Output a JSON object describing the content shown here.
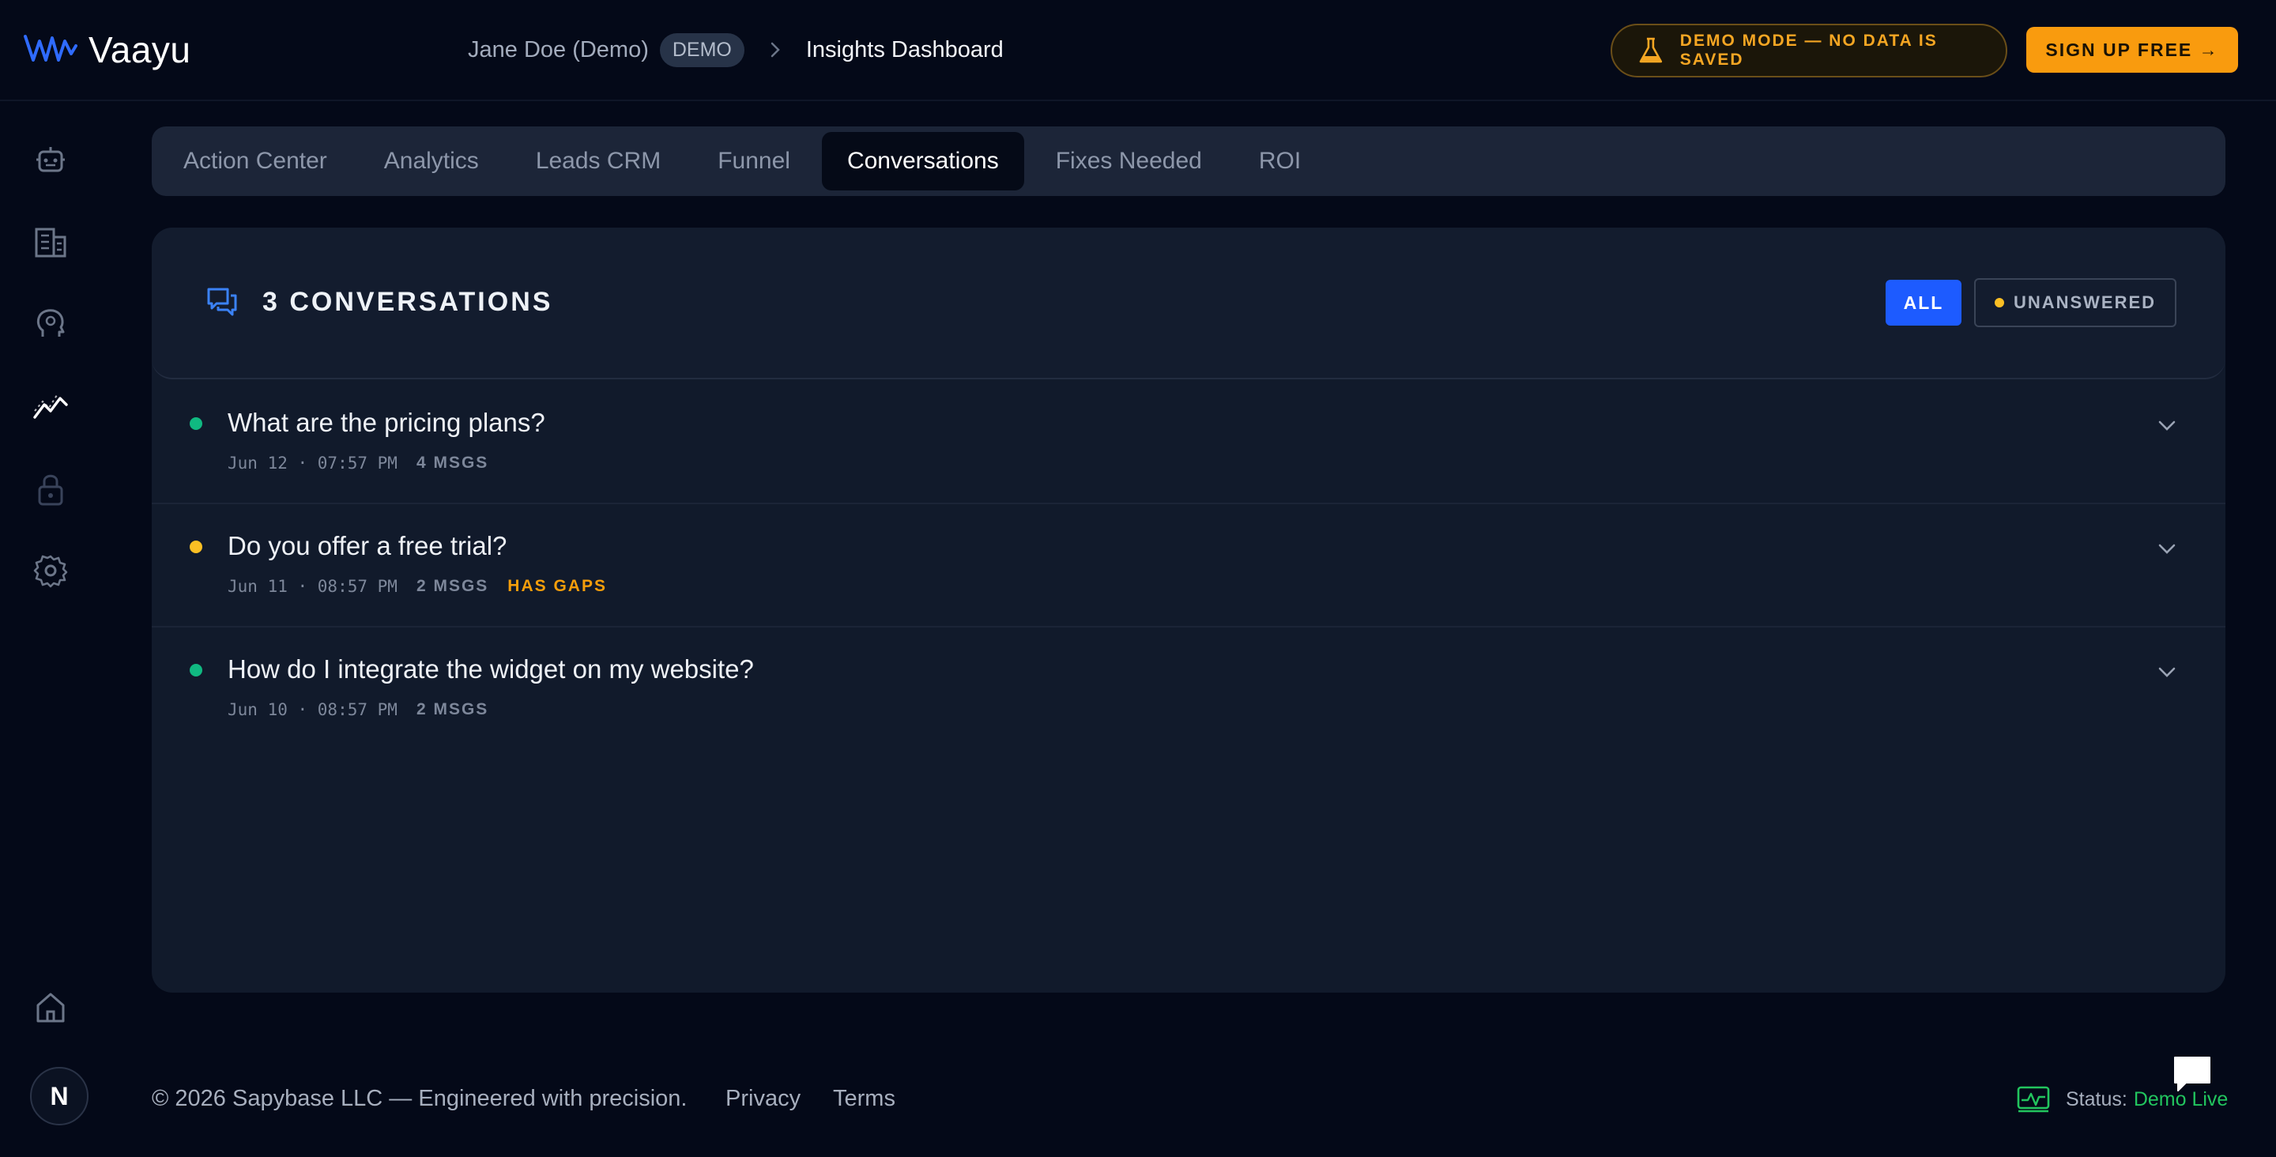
{
  "app": {
    "name": "Vaayu"
  },
  "breadcrumb": {
    "user": "Jane Doe (Demo)",
    "badge": "DEMO",
    "current": "Insights Dashboard"
  },
  "header": {
    "demo_mode": "DEMO MODE — NO DATA IS SAVED",
    "signup": "SIGN UP FREE →"
  },
  "sidebar": {
    "icons": [
      "bot-icon",
      "building-icon",
      "brain-icon",
      "insights-chart-icon",
      "lock-icon",
      "settings-icon",
      "home-icon"
    ],
    "active": "insights-chart-icon",
    "avatar_letter": "N"
  },
  "tabs": [
    {
      "label": "Action Center",
      "active": false
    },
    {
      "label": "Analytics",
      "active": false
    },
    {
      "label": "Leads CRM",
      "active": false
    },
    {
      "label": "Funnel",
      "active": false
    },
    {
      "label": "Conversations",
      "active": true
    },
    {
      "label": "Fixes Needed",
      "active": false
    },
    {
      "label": "ROI",
      "active": false
    }
  ],
  "panel": {
    "title": "3 CONVERSATIONS",
    "filters": {
      "all": "ALL",
      "unanswered": "UNANSWERED"
    }
  },
  "conversations": [
    {
      "title": "What are the pricing plans?",
      "date": "Jun 12 · 07:57 PM",
      "msgs": "4 MSGS",
      "gap": "",
      "status_color": "#10b981"
    },
    {
      "title": "Do you offer a free trial?",
      "date": "Jun 11 · 08:57 PM",
      "msgs": "2 MSGS",
      "gap": "HAS GAPS",
      "status_color": "#fbbf24"
    },
    {
      "title": "How do I integrate the widget on my website?",
      "date": "Jun 10 · 08:57 PM",
      "msgs": "2 MSGS",
      "gap": "",
      "status_color": "#10b981"
    }
  ],
  "footer": {
    "copyright": "© 2026 Sapybase LLC — Engineered with precision.",
    "privacy": "Privacy",
    "terms": "Terms",
    "status_label": "Status:",
    "status_value": "Demo Live"
  },
  "colors": {
    "accent_blue": "#1d5bff",
    "accent_orange": "#f99b0e",
    "status_green": "#22c55e"
  }
}
